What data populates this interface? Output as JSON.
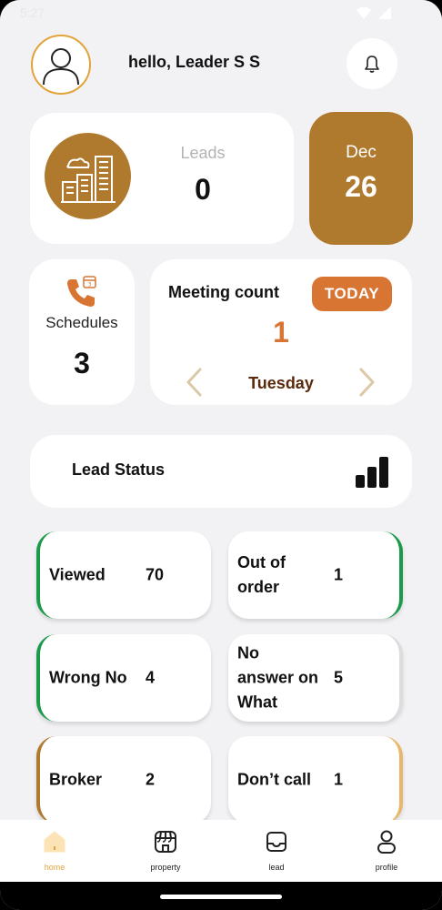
{
  "status_bar": {
    "time": "5:27"
  },
  "header": {
    "greeting": "hello, Leader S S"
  },
  "leads": {
    "label": "Leads",
    "value": "0"
  },
  "date": {
    "month": "Dec",
    "day": "26"
  },
  "schedules": {
    "label": "Schedules",
    "value": "3"
  },
  "meeting": {
    "title": "Meeting count",
    "badge": "TODAY",
    "count": "1",
    "day": "Tuesday"
  },
  "lead_status": {
    "title": "Lead Status"
  },
  "status_tiles": [
    {
      "label": "Viewed",
      "value": "70",
      "color": "#1a9a4a"
    },
    {
      "label": "Out of order",
      "value": "1",
      "color": "#1a9a4a"
    },
    {
      "label": "Wrong No",
      "value": "4",
      "color": "#1a9a4a"
    },
    {
      "label": "No answer on What",
      "value": "5",
      "color": "#dddddd"
    },
    {
      "label": "Broker",
      "value": "2",
      "color": "#b07a2e"
    },
    {
      "label": "Don’t call",
      "value": "1",
      "color": "#e8b86a"
    }
  ],
  "nav": {
    "items": [
      {
        "label": "home",
        "icon": "home-icon",
        "active": true
      },
      {
        "label": "property",
        "icon": "storefront-icon"
      },
      {
        "label": "lead",
        "icon": "inbox-icon"
      },
      {
        "label": "profile",
        "icon": "person-icon"
      }
    ]
  },
  "colors": {
    "accent": "#b07a2e",
    "orange": "#d97533",
    "green": "#1a9a4a",
    "bg": "#f2f1f4"
  }
}
